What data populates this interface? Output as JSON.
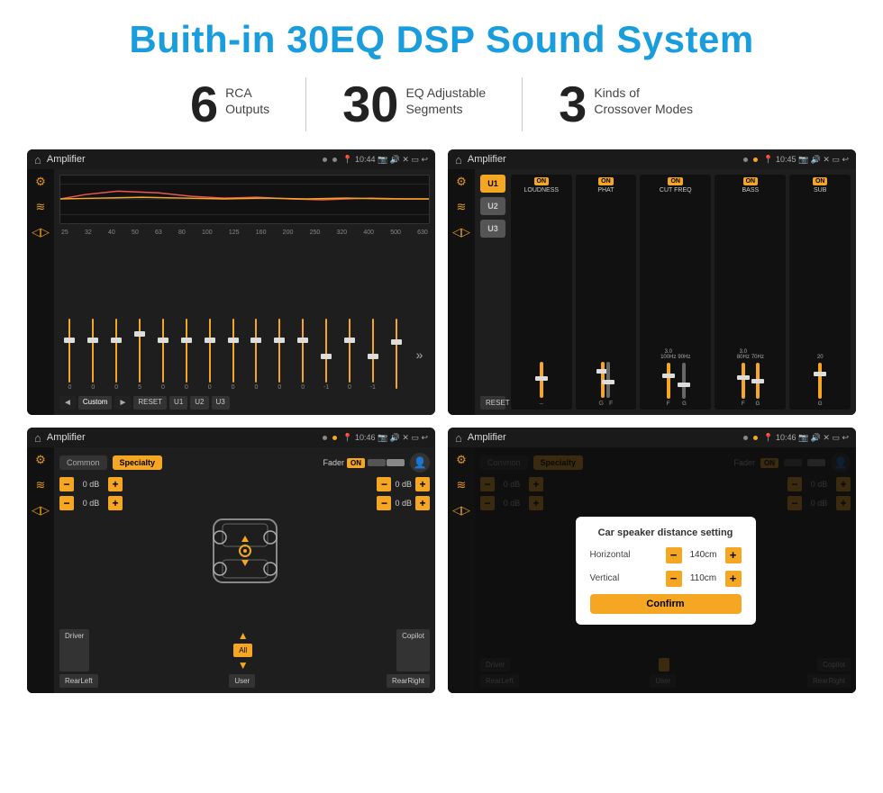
{
  "header": {
    "title": "Buith-in 30EQ DSP Sound System"
  },
  "stats": [
    {
      "number": "6",
      "label": "RCA\nOutputs"
    },
    {
      "number": "30",
      "label": "EQ Adjustable\nSegments"
    },
    {
      "number": "3",
      "label": "Kinds of\nCrossover Modes"
    }
  ],
  "screens": [
    {
      "id": "eq-screen",
      "appName": "Amplifier",
      "time": "10:44",
      "type": "eq"
    },
    {
      "id": "crossover-screen",
      "appName": "Amplifier",
      "time": "10:45",
      "type": "crossover"
    },
    {
      "id": "fader-screen",
      "appName": "Amplifier",
      "time": "10:46",
      "type": "fader"
    },
    {
      "id": "fader-dialog-screen",
      "appName": "Amplifier",
      "time": "10:46",
      "type": "fader-dialog"
    }
  ],
  "eq": {
    "frequencies": [
      "25",
      "32",
      "40",
      "50",
      "63",
      "80",
      "100",
      "125",
      "160",
      "200",
      "250",
      "320",
      "400",
      "500",
      "630"
    ],
    "values": [
      "0",
      "0",
      "0",
      "5",
      "0",
      "0",
      "0",
      "0",
      "0",
      "0",
      "0",
      "-1",
      "0",
      "-1",
      ""
    ],
    "buttons": [
      "Custom",
      "RESET",
      "U1",
      "U2",
      "U3"
    ]
  },
  "crossover": {
    "presets": [
      "U1",
      "U2",
      "U3"
    ],
    "channels": [
      {
        "label": "LOUDNESS",
        "on": true
      },
      {
        "label": "PHAT",
        "on": true
      },
      {
        "label": "CUT FREQ",
        "on": true
      },
      {
        "label": "BASS",
        "on": true
      },
      {
        "label": "SUB",
        "on": true
      }
    ]
  },
  "fader": {
    "tabs": [
      "Common",
      "Specialty"
    ],
    "activeTab": "Specialty",
    "controls": [
      {
        "label": "0 dB"
      },
      {
        "label": "0 dB"
      },
      {
        "label": "0 dB"
      },
      {
        "label": "0 dB"
      }
    ],
    "buttons": [
      "Driver",
      "All",
      "User",
      "RearRight",
      "Copilot",
      "RearLeft"
    ]
  },
  "dialog": {
    "title": "Car speaker distance setting",
    "fields": [
      {
        "label": "Horizontal",
        "value": "140cm"
      },
      {
        "label": "Vertical",
        "value": "110cm"
      }
    ],
    "confirmLabel": "Confirm"
  }
}
